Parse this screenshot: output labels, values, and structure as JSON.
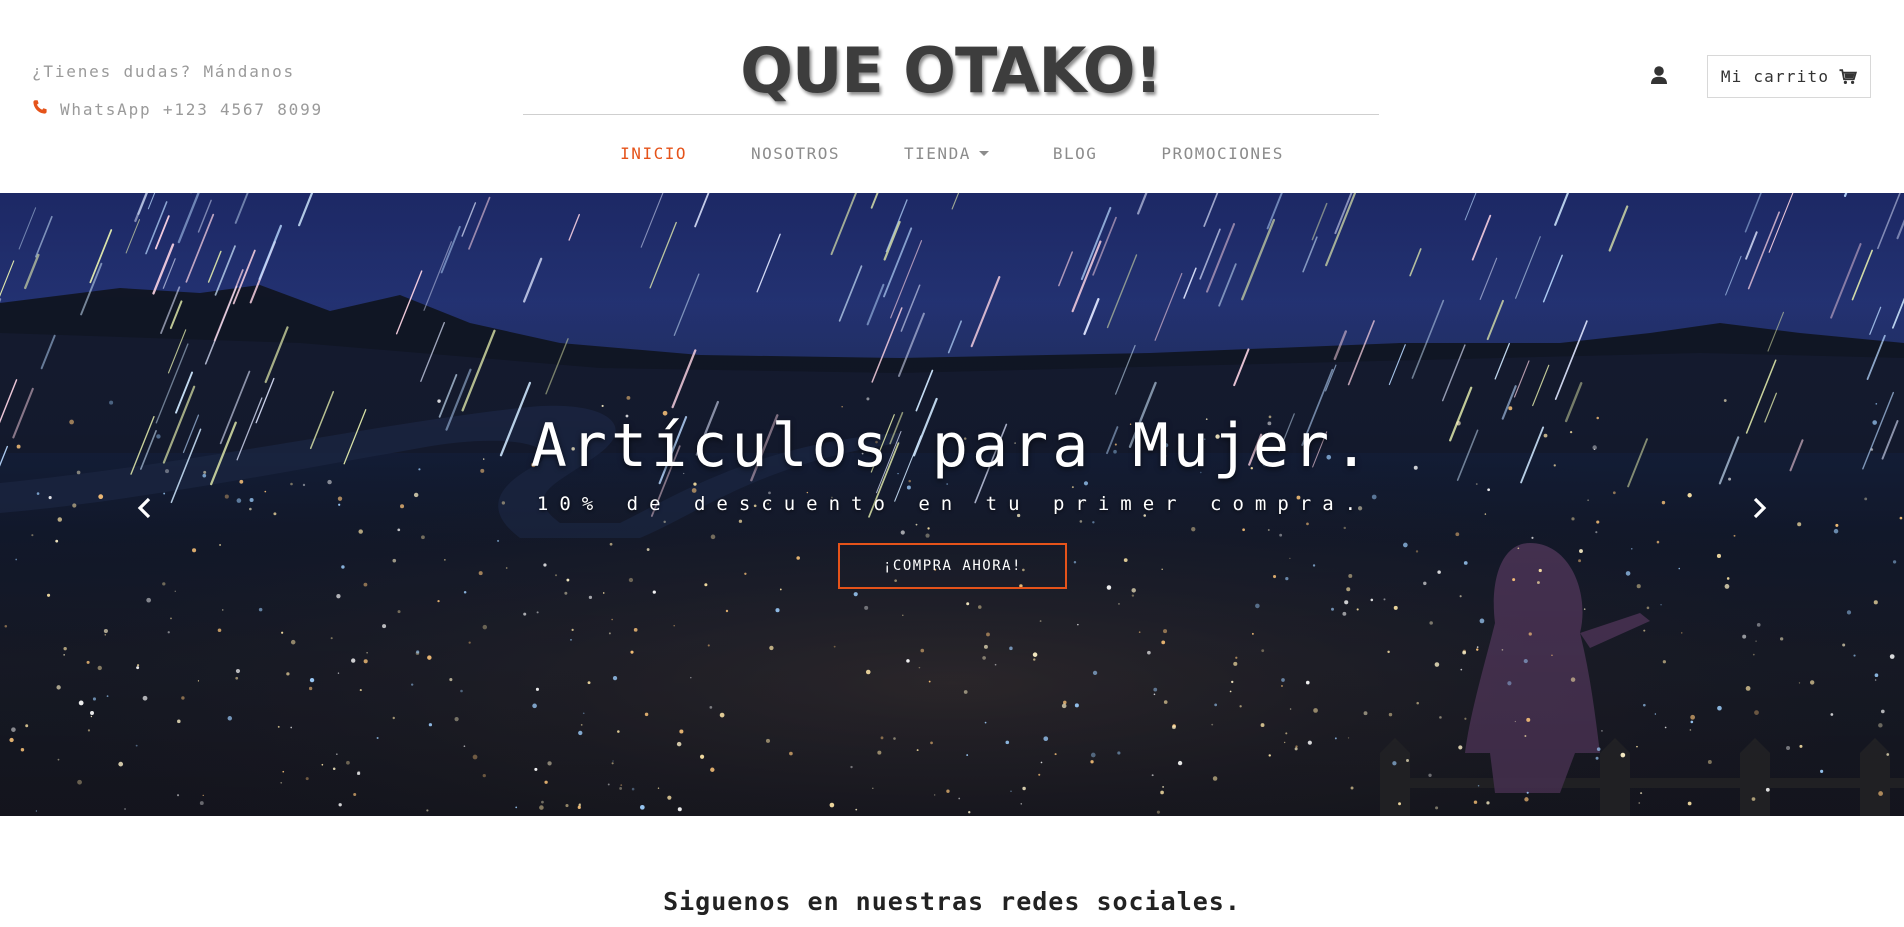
{
  "header": {
    "contact_question": "¿Tienes dudas? Mándanos",
    "contact_whatsapp": "WhatsApp +123 4567 8099",
    "logo_text": "QUE OTAKO!",
    "cart_label": "Mi carrito",
    "accent_color": "#e5531a"
  },
  "nav": {
    "items": [
      {
        "label": "INICIO",
        "active": true
      },
      {
        "label": "NOSOTROS",
        "active": false
      },
      {
        "label": "TIENDA",
        "active": false,
        "dropdown": true
      },
      {
        "label": "BLOG",
        "active": false
      },
      {
        "label": "PROMOCIONES",
        "active": false
      }
    ]
  },
  "hero": {
    "title": "Artículos para Mujer.",
    "subtitle": "10% de descuento en tu primer compra.",
    "cta_label": "¡COMPRA AHORA!"
  },
  "social": {
    "heading": "Siguenos en nuestras redes sociales."
  },
  "icons": {
    "phone": "phone-icon",
    "user": "user-icon",
    "cart": "cart-icon",
    "prev": "chevron-left-icon",
    "next": "chevron-right-icon"
  }
}
